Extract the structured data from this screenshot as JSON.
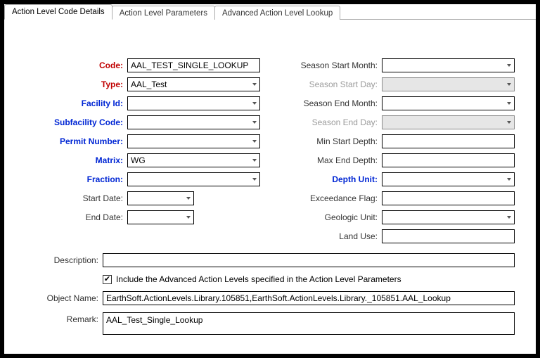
{
  "tabs": {
    "t1": "Action Level Code Details",
    "t2": "Action Level Parameters",
    "t3": "Advanced Action Level Lookup"
  },
  "left": {
    "code_lbl": "Code:",
    "code_val": "AAL_TEST_SINGLE_LOOKUP",
    "type_lbl": "Type:",
    "type_val": "AAL_Test",
    "facility_lbl": "Facility Id:",
    "facility_val": "",
    "subfacility_lbl": "Subfacility Code:",
    "subfacility_val": "",
    "permit_lbl": "Permit Number:",
    "permit_val": "",
    "matrix_lbl": "Matrix:",
    "matrix_val": "WG",
    "fraction_lbl": "Fraction:",
    "fraction_val": "",
    "startdate_lbl": "Start Date:",
    "startdate_val": "",
    "enddate_lbl": "End Date:",
    "enddate_val": ""
  },
  "right": {
    "ssm_lbl": "Season Start Month:",
    "ssm_val": "",
    "ssd_lbl": "Season Start Day:",
    "ssd_val": "",
    "sem_lbl": "Season End Month:",
    "sem_val": "",
    "sed_lbl": "Season End Day:",
    "sed_val": "",
    "minstart_lbl": "Min Start Depth:",
    "minstart_val": "",
    "maxend_lbl": "Max End Depth:",
    "maxend_val": "",
    "depthunit_lbl": "Depth Unit:",
    "depthunit_val": "",
    "exflag_lbl": "Exceedance Flag:",
    "exflag_val": "",
    "geologic_lbl": "Geologic Unit:",
    "geologic_val": "",
    "landuse_lbl": "Land Use:",
    "landuse_val": ""
  },
  "bottom": {
    "description_lbl": "Description:",
    "description_val": "",
    "include_chk": true,
    "include_lbl": "Include the Advanced Action Levels specified in the Action Level Parameters",
    "objectname_lbl": "Object Name:",
    "objectname_val": "EarthSoft.ActionLevels.Library.105851,EarthSoft.ActionLevels.Library._105851.AAL_Lookup",
    "remark_lbl": "Remark:",
    "remark_val": "AAL_Test_Single_Lookup"
  }
}
